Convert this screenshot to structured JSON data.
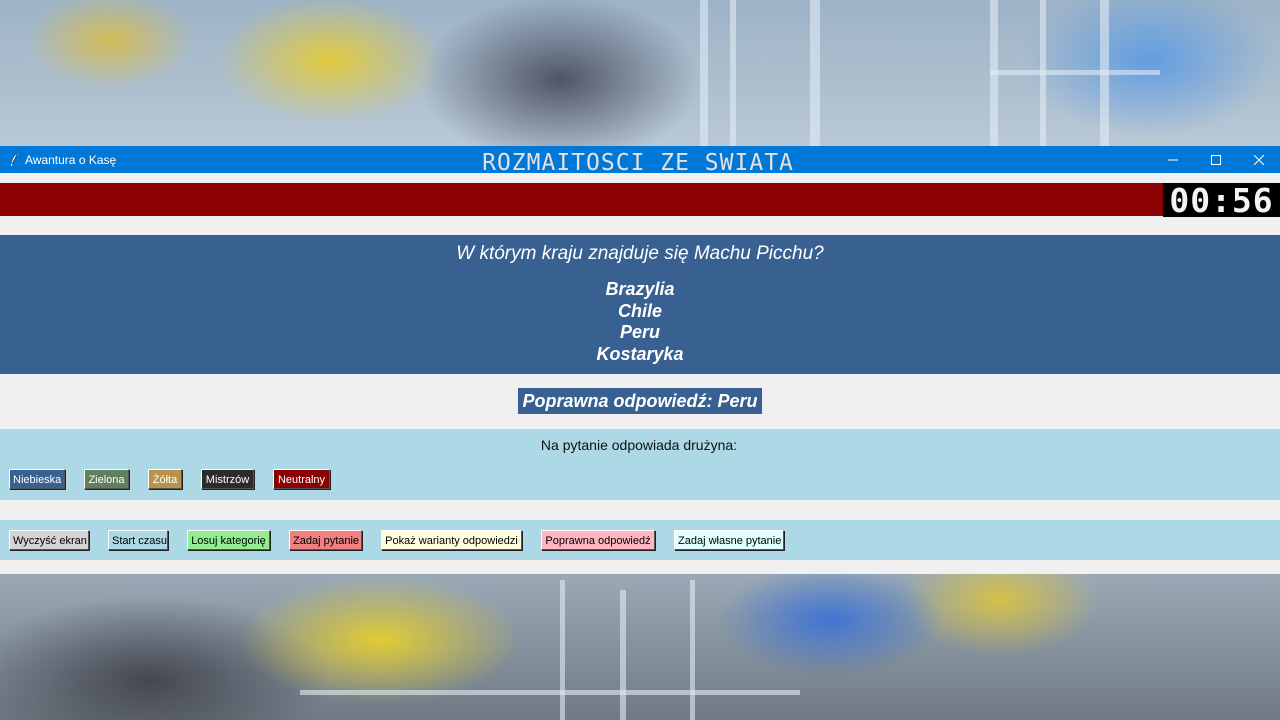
{
  "window": {
    "title": "Awantura o Kasę"
  },
  "header": {
    "category": "ROZMAITOSCI ZE SWIATA",
    "timer": "00:56"
  },
  "question": {
    "text": "W którym kraju znajduje się Machu Picchu?",
    "answers": [
      "Brazylia",
      "Chile",
      "Peru",
      "Kostaryka"
    ]
  },
  "correct_answer": "Poprawna odpowiedź: Peru",
  "teams": {
    "label": "Na pytanie odpowiada drużyna:",
    "buttons": [
      {
        "label": "Niebieska",
        "bg": "#386090",
        "fg": "#ffffff"
      },
      {
        "label": "Zielona",
        "bg": "#5f7f5f",
        "fg": "#ffffff"
      },
      {
        "label": "Żółta",
        "bg": "#b8934a",
        "fg": "#ffffff"
      },
      {
        "label": "Mistrzów",
        "bg": "#2b2b2b",
        "fg": "#ffffff"
      },
      {
        "label": "Neutralny",
        "bg": "#8b0000",
        "fg": "#ffffff"
      }
    ]
  },
  "actions": [
    {
      "label": "Wyczyść ekran",
      "bg": "#d3d3d3"
    },
    {
      "label": "Start czasu",
      "bg": "#add8e6"
    },
    {
      "label": "Losuj kategorię",
      "bg": "#90ee90"
    },
    {
      "label": "Zadaj pytanie",
      "bg": "#f08080"
    },
    {
      "label": "Pokaż warianty odpowiedzi",
      "bg": "#ffffe0"
    },
    {
      "label": "Poprawna odpowiedź",
      "bg": "#ffb6c1"
    },
    {
      "label": "Zadaj własne pytanie",
      "bg": "#e0ffff"
    }
  ]
}
